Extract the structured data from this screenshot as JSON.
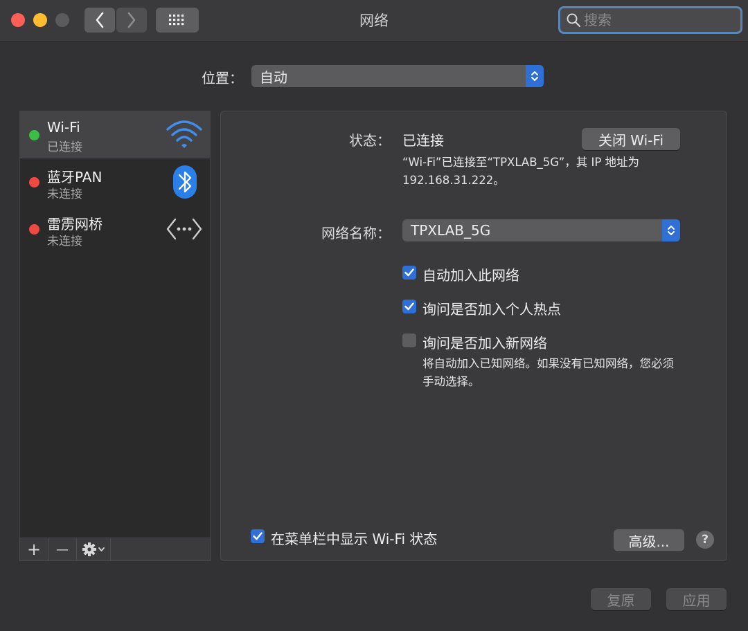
{
  "window": {
    "title": "网络"
  },
  "search": {
    "placeholder": "搜索"
  },
  "location": {
    "label": "位置：",
    "value": "自动"
  },
  "services": [
    {
      "name": "Wi-Fi",
      "status": "已连接",
      "status_color": "#3dbd48",
      "icon": "wifi-icon"
    },
    {
      "name": "蓝牙PAN",
      "status": "未连接",
      "status_color": "#ee4a43",
      "icon": "bluetooth-icon"
    },
    {
      "name": "雷雳网桥",
      "status": "未连接",
      "status_color": "#ee4a43",
      "icon": "thunderbolt-bridge-icon"
    }
  ],
  "sidebar_tools": {
    "add": "+",
    "remove": "—"
  },
  "detail": {
    "status_label": "状态：",
    "status_value": "已连接",
    "toggle_wifi_button": "关闭 Wi-Fi",
    "status_desc_line1": "“Wi-Fi”已连接至“TPXLAB_5G”，其 IP 地址为",
    "status_desc_line2": "192.168.31.222。",
    "network_name_label": "网络名称：",
    "network_name_value": "TPXLAB_5G",
    "auto_join": {
      "label": "自动加入此网络",
      "checked": true
    },
    "ask_hotspot": {
      "label": "询问是否加入个人热点",
      "checked": true
    },
    "ask_new": {
      "label": "询问是否加入新网络",
      "checked": false
    },
    "ask_new_desc_line1": "将自动加入已知网络。如果没有已知网络，您必须",
    "ask_new_desc_line2": "手动选择。",
    "show_in_menubar": {
      "label": "在菜单栏中显示 Wi-Fi 状态",
      "checked": true
    },
    "advanced_button": "高级...",
    "help": "?"
  },
  "footer": {
    "revert_button": "复原",
    "apply_button": "应用"
  },
  "colors": {
    "accent": "#2f6fd6",
    "connected": "#3dbd48",
    "disconnected": "#ee4a43"
  }
}
